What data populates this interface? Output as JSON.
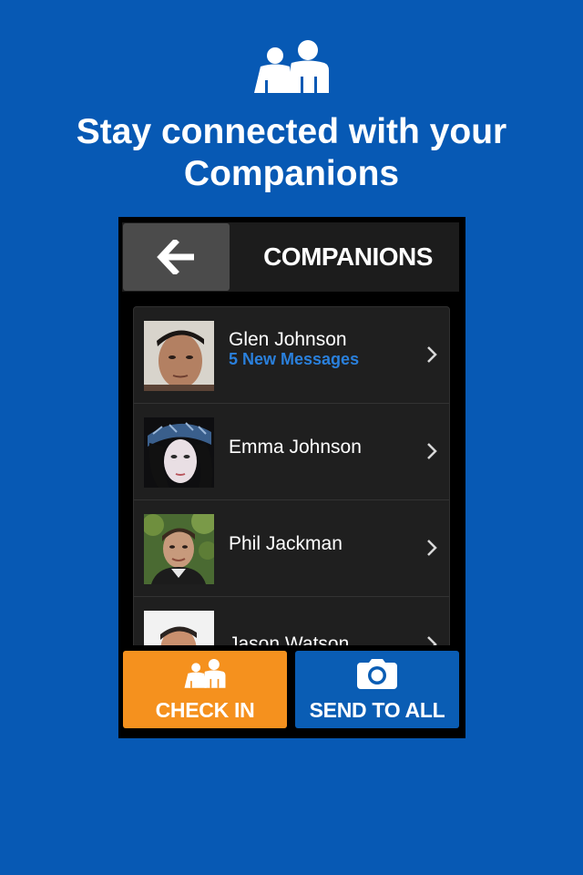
{
  "hero": {
    "icon": "companions-icon",
    "headline_line1": "Stay connected with your",
    "headline_line2": "Companions"
  },
  "header": {
    "back_icon": "arrow-left-icon",
    "title": "COMPANIONS"
  },
  "companions": [
    {
      "name": "Glen Johnson",
      "messages": "5 New Messages"
    },
    {
      "name": "Emma Johnson"
    },
    {
      "name": "Phil Jackman"
    },
    {
      "name": "Jason  Watson"
    }
  ],
  "actions": {
    "check_in": {
      "label": "CHECK IN",
      "icon": "companions-icon"
    },
    "send_to_all": {
      "label": "SEND TO ALL",
      "icon": "camera-icon"
    }
  },
  "colors": {
    "background": "#0759b4",
    "check_in": "#f5911e",
    "send_to_all": "#0a5db4",
    "message_accent": "#2a80dc"
  }
}
